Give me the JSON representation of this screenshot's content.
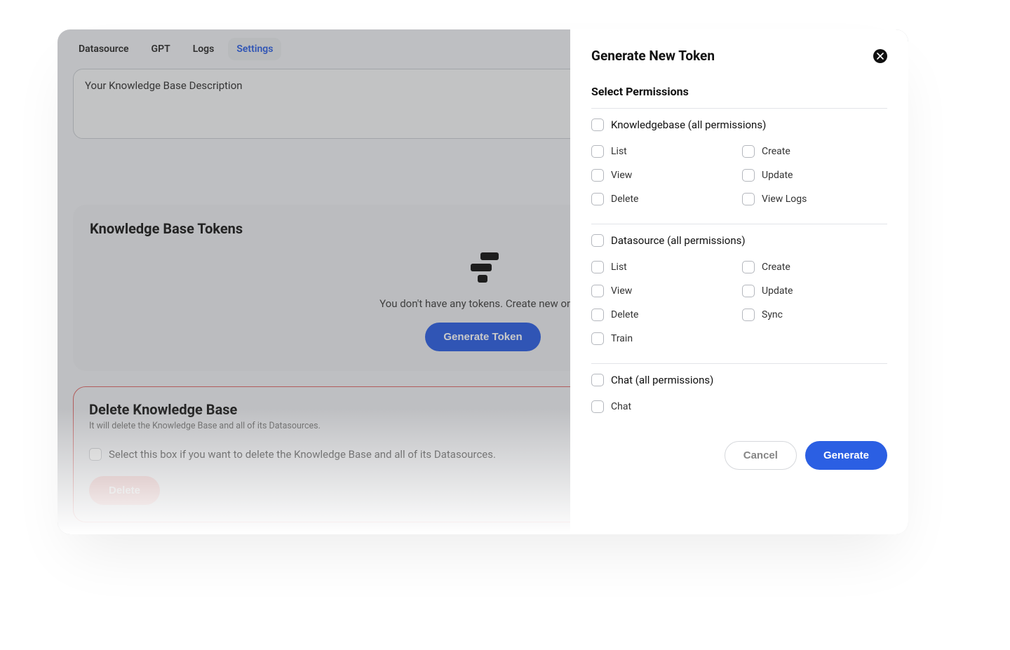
{
  "tabs": {
    "datasource": "Datasource",
    "gpt": "GPT",
    "logs": "Logs",
    "settings": "Settings"
  },
  "description": {
    "value": "Your Knowledge Base Description"
  },
  "tokens_card": {
    "title": "Knowledge Base Tokens",
    "empty_text": "You don't have any tokens. Create new ones!",
    "generate_label": "Generate Token"
  },
  "delete_card": {
    "title": "Delete Knowledge Base",
    "subtitle": "It will delete the Knowledge Base and all of its Datasources.",
    "confirm_label": "Select this box if you want to delete the Knowledge Base and all of its Datasources.",
    "delete_label": "Delete"
  },
  "drawer": {
    "title": "Generate New Token",
    "subtitle": "Select Permissions",
    "groups": [
      {
        "all_label": "Knowledgebase (all permissions)",
        "perms_left": [
          "List",
          "View",
          "Delete"
        ],
        "perms_right": [
          "Create",
          "Update",
          "View Logs"
        ]
      },
      {
        "all_label": "Datasource (all permissions)",
        "perms_left": [
          "List",
          "View",
          "Delete",
          "Train"
        ],
        "perms_right": [
          "Create",
          "Update",
          "Sync"
        ]
      },
      {
        "all_label": "Chat (all permissions)",
        "perms_left": [
          "Chat"
        ],
        "perms_right": []
      }
    ],
    "cancel_label": "Cancel",
    "generate_label": "Generate"
  }
}
